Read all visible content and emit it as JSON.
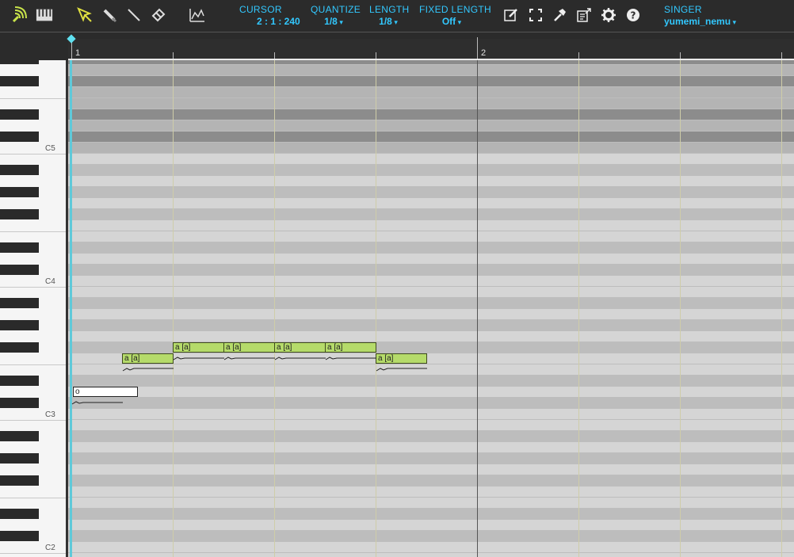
{
  "toolbar": {
    "cursor": {
      "label": "CURSOR",
      "value": "2 : 1 : 240"
    },
    "quantize": {
      "label": "QUANTIZE",
      "value": "1/8"
    },
    "length": {
      "label": "LENGTH",
      "value": "1/8"
    },
    "fixed_length": {
      "label": "FIXED LENGTH",
      "value": "Off"
    },
    "singer": {
      "label": "SINGER",
      "value": "yumemi_nemu"
    },
    "accent_color": "#32c8ff"
  },
  "ruler": {
    "measures": [
      "1",
      "2"
    ]
  },
  "keyboard": {
    "octave_labels": [
      "C5",
      "C4",
      "C3",
      "C2"
    ]
  },
  "notes": [
    {
      "lyric": "a [a]"
    },
    {
      "lyric": "a [a]"
    },
    {
      "lyric": "a [a]"
    },
    {
      "lyric": "a [a]"
    },
    {
      "lyric": "a [a]"
    },
    {
      "lyric": "a [a]"
    }
  ],
  "editing_note": {
    "value": "o"
  },
  "colors": {
    "note_fill": "#b5db6a",
    "playhead": "#5fc9d9"
  }
}
